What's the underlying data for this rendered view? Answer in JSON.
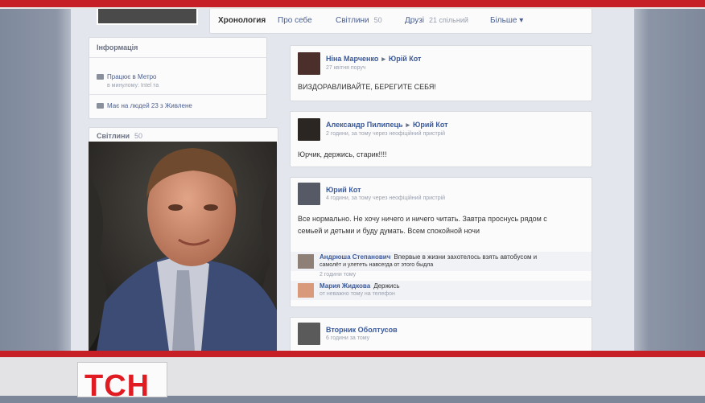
{
  "nav": {
    "tabs": [
      {
        "label": "Хронология"
      },
      {
        "label": "Про себе"
      },
      {
        "label": "Світлини",
        "count": "50"
      },
      {
        "label": "Друзі",
        "count": "21 спільний"
      },
      {
        "label": "Більше"
      }
    ]
  },
  "info": {
    "title": "Інформація",
    "rows": [
      {
        "text": "Працює в Метро",
        "sub": "в минулому: Intel та"
      },
      {
        "text": "Має на людей 23 з Живлене"
      }
    ]
  },
  "photos": {
    "label": "Світлини",
    "count": "50"
  },
  "posts": [
    {
      "author": "Ніна Марченко",
      "target": "Юрій Кот",
      "meta": "27 квітня поруч",
      "lines": [
        "ВИЗДОРАВЛИВАЙТЕ, БЕРЕГИТЕ СЕБЯ!"
      ]
    },
    {
      "author": "Александр Пилипець",
      "target": "Юрий Кот",
      "meta": "2 години, за тому через неофіційний пристрій",
      "lines": [
        "Юрчик, держись, старик!!!!"
      ]
    },
    {
      "author": "Юрий Кот",
      "meta": "4 години, за тому через неофіційний пристрій",
      "lines": [
        "Все нормально. Не хочу ничего и ничего читать. Завтра проснусь рядом с",
        "семьей и детьми и буду думать. Всем спокойной ночи"
      ],
      "comments": [
        {
          "name": "Андрюша Степанович",
          "text": "Впервые в жизни захотелось взять автобусом и",
          "text2": "самолёт и улететь навсегда от этого быдла",
          "meta": "2 години тому"
        },
        {
          "name": "Мария Жидкова",
          "text": "Держись",
          "meta": "от неважно тому на телефон"
        }
      ]
    },
    {
      "author": "Вторник Оболтусов",
      "meta": "6 години за тому"
    }
  ],
  "colors": {
    "tv_red": "#c62026",
    "fb_link": "#3b5998"
  },
  "logo": "ТСН"
}
